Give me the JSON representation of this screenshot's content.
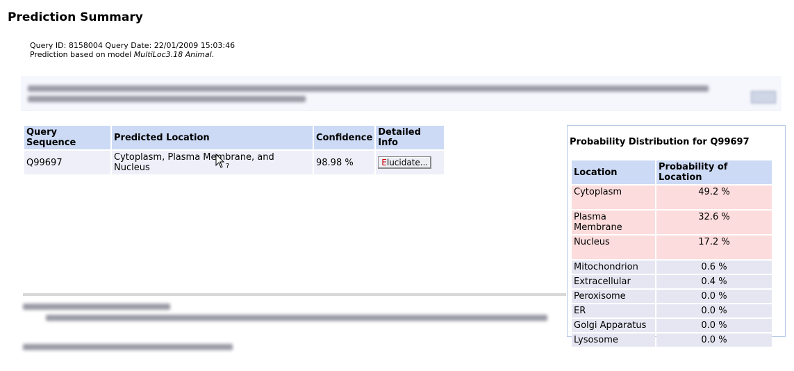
{
  "page": {
    "title": "Prediction Summary",
    "query_id_label": "Query ID:",
    "query_id": "8158004",
    "query_date_label": "Query Date:",
    "query_date": "22/01/2009 15:03:46",
    "model_prefix": "Prediction based on model ",
    "model_name": "MultiLoc3.18 Animal",
    "model_suffix": "."
  },
  "results_table": {
    "headers": [
      "Query Sequence",
      "Predicted Location",
      "Confidence",
      "Detailed Info"
    ],
    "rows": [
      {
        "sequence": "Q99697",
        "location": "Cytoplasm, Plasma Membrane, and Nucleus",
        "confidence": "98.98 %",
        "button_hotkey": "E",
        "button_rest": "lucidate..."
      }
    ]
  },
  "probability_panel": {
    "title": "Probability Distribution for Q99697",
    "headers": [
      "Location",
      "Probability of Location"
    ],
    "rows": [
      {
        "location": "Cytoplasm",
        "probability": "49.2 %"
      },
      {
        "location": "Plasma Membrane",
        "probability": "32.6 %"
      },
      {
        "location": "Nucleus",
        "probability": "17.2 %"
      },
      {
        "location": "Mitochondrion",
        "probability": "0.6 %"
      },
      {
        "location": "Extracellular",
        "probability": "0.4 %"
      },
      {
        "location": "Peroxisome",
        "probability": "0.0 %"
      },
      {
        "location": "ER",
        "probability": "0.0 %"
      },
      {
        "location": "Golgi Apparatus",
        "probability": "0.0 %"
      },
      {
        "location": "Lysosome",
        "probability": "0.0 %"
      }
    ]
  },
  "colors": {
    "header_bg": "#ccdaf5",
    "row_bg": "#eeeff8",
    "high_prob_bg": "#fcdcdc",
    "low_prob_bg": "#e6e6f2",
    "button_hotkey": "#cc0000"
  },
  "icons": {
    "cursor": "arrow-help-cursor-icon"
  }
}
